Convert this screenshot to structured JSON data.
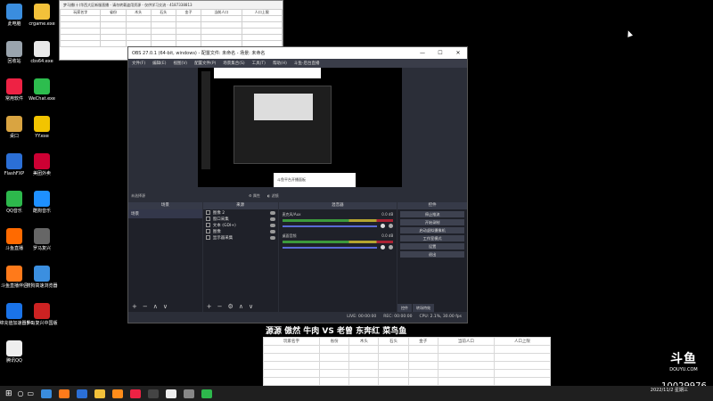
{
  "desktop_icons": [
    {
      "label": "此电脑",
      "color": "#3a8dde"
    },
    {
      "label": "crgame.exe",
      "color": "#f3c13a"
    },
    {
      "label": "回收站",
      "color": "#9aa4ad"
    },
    {
      "label": "cbs64.exe",
      "color": "#e9e9e9"
    },
    {
      "label": "常用软件",
      "color": "#e24"
    },
    {
      "label": "WeChat.exe",
      "color": "#2dbd4e"
    },
    {
      "label": "桌口",
      "color": "#d9a441"
    },
    {
      "label": "YY.exe",
      "color": "#f2c400"
    },
    {
      "label": "FlashFXP",
      "color": "#2b6fd6"
    },
    {
      "label": "美团外卖",
      "color": "#c03"
    },
    {
      "label": "QQ音乐",
      "color": "#2db84c"
    },
    {
      "label": "酷狗音乐",
      "color": "#1e90ff"
    },
    {
      "label": "斗鱼直播",
      "color": "#ff6a00"
    },
    {
      "label": "罗马复兴",
      "color": "#666"
    },
    {
      "label": "斗鱼直播伴侣",
      "color": "#ff7a1a"
    },
    {
      "label": "搜狗高速浏览器",
      "color": "#3b8fe0"
    },
    {
      "label": "海绵充值加速器5.0",
      "color": "#1a73e8"
    },
    {
      "label": "罗马复兴中国版",
      "color": "#c22"
    },
    {
      "label": "腾讯QQ",
      "color": "#eee"
    }
  ],
  "sheet_window": {
    "title": "梦马播(十)华西大区新服直播 - 请勿转载盗用资源 - 仅供学习交流 - 4187338813",
    "columns": [
      "玩家名字",
      "省份",
      "木头",
      "石头",
      "金子",
      "当前人口",
      "人口上限"
    ]
  },
  "obs": {
    "title": "OBS 27.0.1 (64-bit, windows) - 配置文件: 未命名 - 场景: 未命名",
    "menu": [
      "文件(F)",
      "编辑(E)",
      "视图(V)",
      "配置文件(P)",
      "场景集合(S)",
      "工具(T)",
      "帮助(H)",
      "斗鱼-后台直播"
    ],
    "preview_popup": "斗鱼平台开播面板",
    "no_source": "未选择源",
    "props_label": "属性",
    "filters_label": "滤镜",
    "docks": {
      "scenes": {
        "title": "场景",
        "items": [
          "场景"
        ]
      },
      "sources": {
        "title": "来源",
        "items": [
          "图像 2",
          "窗口采集",
          "文本 (GDI+)",
          "图像",
          "显示器采集"
        ]
      },
      "mixer": {
        "title": "混音器",
        "channels": [
          {
            "name": "麦克风/Aux",
            "db": "0.0 dB"
          },
          {
            "name": "桌面音频",
            "db": "0.0 dB"
          }
        ]
      },
      "controls": {
        "title": "控件",
        "buttons": [
          "停止推流",
          "开始录制",
          "启动虚拟摄像机",
          "工作室模式",
          "设置",
          "退出"
        ]
      }
    },
    "tabs": [
      "控件",
      "转场特效"
    ],
    "status": {
      "live": "LIVE: 00:00:00",
      "rec": "REC: 00:00:00",
      "cpu": "CPU: 2.1%, 30.00 fps"
    }
  },
  "overlay_text": "源源 傲然 牛肉 VS 老曾 东奔红 菜鸟鱼",
  "bottom_sheet": {
    "columns": [
      "玩家名字",
      "省份",
      "木头",
      "石头",
      "金子",
      "当前人口",
      "人口上限"
    ]
  },
  "watermark": {
    "logo": "斗鱼",
    "sub": "DOUYU.COM",
    "room_id": "10029976"
  },
  "taskbar": {
    "icons": [
      "#3a8dde",
      "#ff7a1a",
      "#2b6fd6",
      "#f3c13a",
      "#ff8c1a",
      "#e24",
      "#444",
      "#eee",
      "#888",
      "#2db84c"
    ],
    "time": "",
    "date": "2022/11/2 星期三"
  }
}
